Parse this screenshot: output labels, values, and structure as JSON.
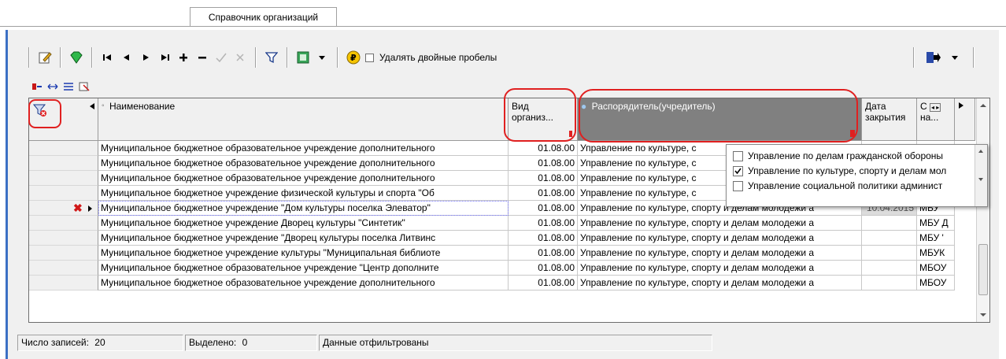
{
  "tab": {
    "label": "Справочник организаций"
  },
  "toolbar": {
    "remove_double_spaces_label": "Удалять двойные пробелы",
    "icons": [
      "edit-icon",
      "gem-icon",
      "first-icon",
      "prev-icon",
      "next-icon",
      "last-icon",
      "add-icon",
      "delete-icon",
      "confirm-icon",
      "cancel-icon",
      "filter-icon",
      "export-icon",
      "dropdown-icon",
      "ruble-icon"
    ]
  },
  "grid": {
    "columns": {
      "name": "Наименование",
      "type_line1": "Вид",
      "type_line2": "организ...",
      "manager": "Распорядитель(учредитель)",
      "close_line1": "Дата",
      "close_line2": "закрытия",
      "short_line1": "С",
      "short_line2": "на..."
    },
    "rows": [
      {
        "name": "Муниципальное бюджетное образовательное учреждение дополнительного",
        "type": "01.08.00",
        "manager": "Управление по культуре, с",
        "closed": "",
        "short": ""
      },
      {
        "name": "Муниципальное бюджетное образовательное учреждение дополнительного",
        "type": "01.08.00",
        "manager": "Управление по культуре, с",
        "closed": "",
        "short": ""
      },
      {
        "name": "Муниципальное бюджетное образовательное учреждение дополнительного",
        "type": "01.08.00",
        "manager": "Управление по культуре, с",
        "closed": "",
        "short": ""
      },
      {
        "name": "Муниципальное бюджетное учреждение физической культуры и спорта \"Об",
        "type": "01.08.00",
        "manager": "Управление по культуре, с",
        "closed": "",
        "short": ""
      },
      {
        "name": "Муниципальное бюджетное учреждение \"Дом культуры поселка Элеватор\"",
        "type": "01.08.00",
        "manager": "Управление по культуре, спорту и делам молодежи а",
        "closed": "10.04.2015",
        "short": "МБУ '"
      },
      {
        "name": "Муниципальное бюджетное учреждение Дворец культуры \"Синтетик\"",
        "type": "01.08.00",
        "manager": "Управление по культуре, спорту и делам молодежи а",
        "closed": "",
        "short": "МБУ Д"
      },
      {
        "name": "Муниципальное бюджетное учреждение \"Дворец культуры поселка Литвинс",
        "type": "01.08.00",
        "manager": "Управление по культуре, спорту и делам молодежи а",
        "closed": "",
        "short": "МБУ '"
      },
      {
        "name": "Муниципальное бюджетное учреждение культуры \"Муниципальная библиоте",
        "type": "01.08.00",
        "manager": "Управление по культуре, спорту и делам молодежи а",
        "closed": "",
        "short": "МБУК"
      },
      {
        "name": "Муниципальное бюджетное образовательное учреждение \"Центр дополните",
        "type": "01.08.00",
        "manager": "Управление по культуре, спорту и делам молодежи а",
        "closed": "",
        "short": "МБОУ"
      },
      {
        "name": "Муниципальное бюджетное  образовательное учреждение дополнительного",
        "type": "01.08.00",
        "manager": "Управление по культуре, спорту и делам молодежи а",
        "closed": "",
        "short": "МБОУ"
      }
    ]
  },
  "filter_popup": {
    "items": [
      {
        "label": "Управление по делам гражданской обороны",
        "checked": false
      },
      {
        "label": "Управление по культуре, спорту и делам мол",
        "checked": true
      },
      {
        "label": "Управление социальной политики админист",
        "checked": false
      }
    ]
  },
  "status": {
    "records_label": "Число записей:",
    "records_value": "20",
    "selected_label": "Выделено:",
    "selected_value": "0",
    "filter_state": "Данные отфильтрованы"
  },
  "colors": {
    "accent_red": "#e02020",
    "header_dark": "#808080",
    "frame_blue": "#3b6fc4"
  }
}
